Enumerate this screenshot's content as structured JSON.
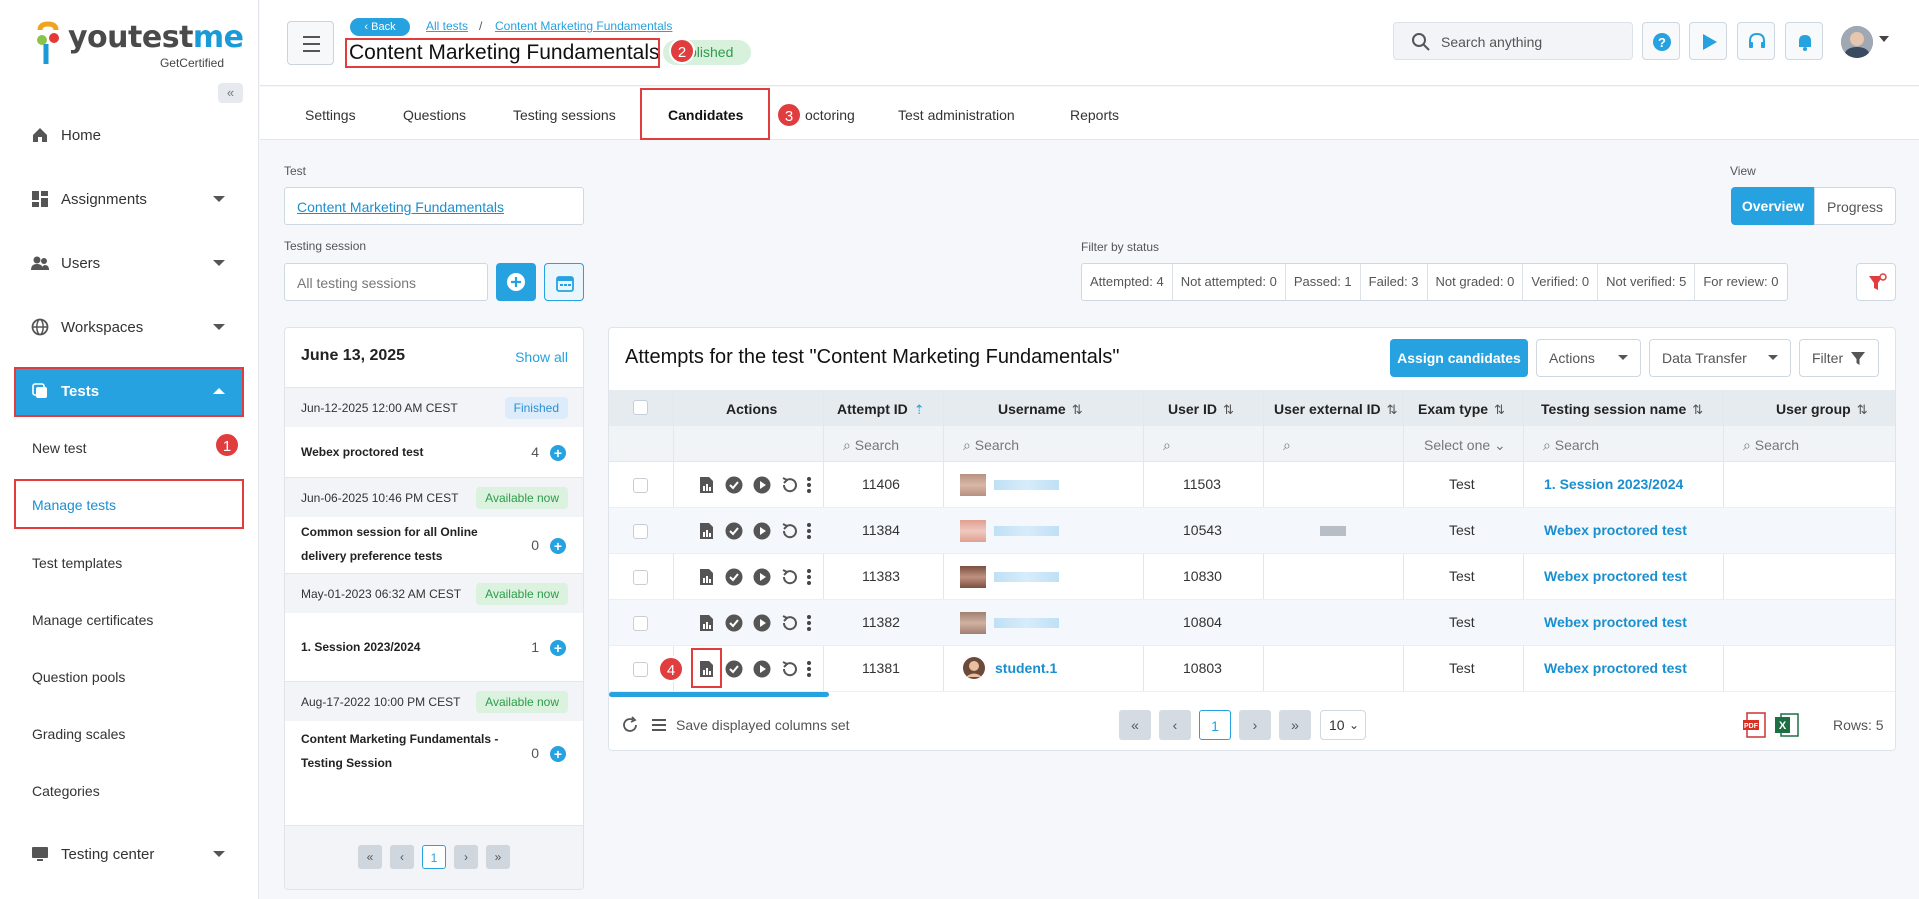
{
  "brand": {
    "name_a": "youtest",
    "name_b": "me",
    "tagline": "GetCertified",
    "accent": "#26a2e0",
    "danger": "#e03e3e"
  },
  "sidebar": {
    "items": [
      {
        "label": "Home",
        "icon": "home-icon"
      },
      {
        "label": "Assignments",
        "icon": "dashboard-icon"
      },
      {
        "label": "Users",
        "icon": "users-icon"
      },
      {
        "label": "Workspaces",
        "icon": "globe-icon"
      },
      {
        "label": "Tests",
        "icon": "copy-icon"
      },
      {
        "label": "Testing center",
        "icon": "monitor-icon"
      }
    ],
    "sub_items": [
      "New test",
      "Manage tests",
      "Test templates",
      "Manage certificates",
      "Question pools",
      "Grading scales",
      "Categories"
    ]
  },
  "annotations": [
    "1",
    "2",
    "3",
    "4"
  ],
  "header": {
    "back_label": "Back",
    "breadcrumbs": [
      "All tests",
      "/",
      "Content Marketing Fundamentals"
    ],
    "title": "Content Marketing Fundamentals",
    "status": "Published",
    "status_visible": "blished",
    "search_placeholder": "Search anything"
  },
  "tabs": [
    "Settings",
    "Questions",
    "Testing sessions",
    "Candidates",
    "Proctoring",
    "Test administration",
    "Reports"
  ],
  "tabs_visible": [
    "Settings",
    "Questions",
    "Testing sessions",
    "Candidates",
    "octoring",
    "Test administration",
    "Reports"
  ],
  "filters": {
    "test_label": "Test",
    "test_value": "Content Marketing Fundamentals",
    "session_label": "Testing session",
    "session_placeholder": "All testing sessions",
    "view_label": "View",
    "view_options": [
      "Overview",
      "Progress"
    ],
    "status_label": "Filter by status",
    "status_items": [
      "Attempted: 4",
      "Not attempted: 0",
      "Passed: 1",
      "Failed: 3",
      "Not graded: 0",
      "Verified: 0",
      "Not verified: 5",
      "For review: 0"
    ]
  },
  "sessions": {
    "date": "June 13, 2025",
    "show_all": "Show all",
    "items": [
      {
        "date": "Jun-12-2025 12:00 AM CEST",
        "badge": "Finished",
        "name": "Webex proctored test",
        "count": "4"
      },
      {
        "date": "Jun-06-2025 10:46 PM CEST",
        "badge": "Available now",
        "name": "Common session for all Online delivery preference tests",
        "count": "0"
      },
      {
        "date": "May-01-2023 06:32 AM CEST",
        "badge": "Available now",
        "name": "1. Session 2023/2024",
        "count": "1"
      },
      {
        "date": "Aug-17-2022 10:00 PM CEST",
        "badge": "Available now",
        "name": "Content Marketing Fundamentals - Testing Session",
        "count": "0"
      }
    ],
    "pager": [
      "«",
      "‹",
      "1",
      "›",
      "»"
    ]
  },
  "grid": {
    "title": "Attempts for the test \"Content Marketing Fundamentals\"",
    "assign_label": "Assign candidates",
    "actions_label": "Actions",
    "transfer_label": "Data Transfer",
    "filter_label": "Filter",
    "columns": [
      "Actions",
      "Attempt ID",
      "Username",
      "User ID",
      "User external ID",
      "Exam type",
      "Testing session name",
      "User group"
    ],
    "search_placeholder": "Search",
    "select_placeholder": "Select one",
    "rows": [
      {
        "attempt": "11406",
        "username": "",
        "user_id": "11503",
        "exam": "Test",
        "session": "1. Session 2023/2024"
      },
      {
        "attempt": "11384",
        "username": "",
        "user_id": "10543",
        "exam": "Test",
        "session": "Webex proctored test"
      },
      {
        "attempt": "11383",
        "username": "",
        "user_id": "10830",
        "exam": "Test",
        "session": "Webex proctored test"
      },
      {
        "attempt": "11382",
        "username": "",
        "user_id": "10804",
        "exam": "Test",
        "session": "Webex proctored test"
      },
      {
        "attempt": "11381",
        "username": "student.1",
        "user_id": "10803",
        "exam": "Test",
        "session": "Webex proctored test"
      }
    ],
    "footer_label": "Save displayed columns set",
    "pager": [
      "«",
      "‹",
      "1",
      "›",
      "»"
    ],
    "page_size": "10",
    "rows_count": "Rows: 5"
  }
}
